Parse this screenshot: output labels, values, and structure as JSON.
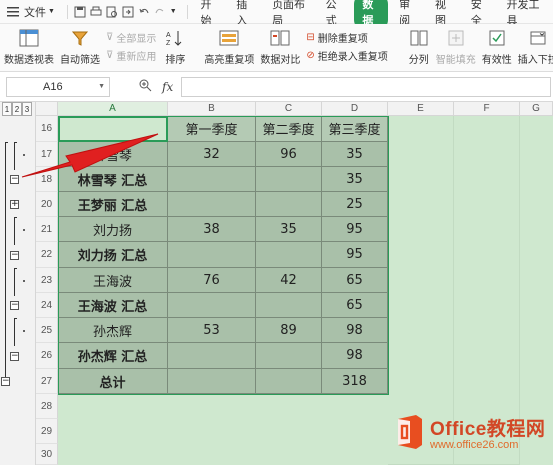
{
  "menu": {
    "file_label": "文件",
    "tabs": [
      "开始",
      "插入",
      "页面布局",
      "公式",
      "数据",
      "审阅",
      "视图",
      "安全",
      "开发工具"
    ],
    "active_tab": "数据"
  },
  "ribbon": {
    "pivot": "数据透视表",
    "autofilter": "自动筛选",
    "show_all": "全部显示",
    "reapply": "重新应用",
    "sort": "排序",
    "highlight_dup": "高亮重复项",
    "compare": "数据对比",
    "remove_dup": "删除重复项",
    "reject_dup": "拒绝录入重复项",
    "split": "分列",
    "smart_fill": "智能填充",
    "validity": "有效性",
    "insert_dropdown": "插入下拉"
  },
  "formula_bar": {
    "cell_ref": "A16",
    "fx": "fx",
    "formula": ""
  },
  "outline": {
    "levels": [
      "1",
      "2",
      "3"
    ]
  },
  "columns": [
    "A",
    "B",
    "C",
    "D",
    "E",
    "F",
    "G"
  ],
  "rows": [
    "16",
    "17",
    "18",
    "20",
    "21",
    "22",
    "23",
    "24",
    "25",
    "26",
    "27",
    "28",
    "29",
    "30"
  ],
  "table": {
    "headers": [
      "",
      "第一季度",
      "第二季度",
      "第三季度"
    ],
    "data": [
      [
        "林雪琴",
        "32",
        "96",
        "35"
      ],
      [
        "林雪琴 汇总",
        "",
        "",
        "35"
      ],
      [
        "王梦丽 汇总",
        "",
        "",
        "25"
      ],
      [
        "刘力扬",
        "38",
        "35",
        "95"
      ],
      [
        "刘力扬 汇总",
        "",
        "",
        "95"
      ],
      [
        "王海波",
        "76",
        "42",
        "65"
      ],
      [
        "王海波 汇总",
        "",
        "",
        "65"
      ],
      [
        "孙杰辉",
        "53",
        "89",
        "98"
      ],
      [
        "孙杰辉 汇总",
        "",
        "",
        "98"
      ],
      [
        "总计",
        "",
        "",
        "318"
      ]
    ]
  },
  "watermark": {
    "brand": "Office教程网",
    "url": "www.office26.com"
  },
  "colors": {
    "accent": "#2a9b58",
    "table_fill": "#a9c0a9",
    "sheet_bg": "#cfe8cf",
    "arrow": "#e02020"
  }
}
